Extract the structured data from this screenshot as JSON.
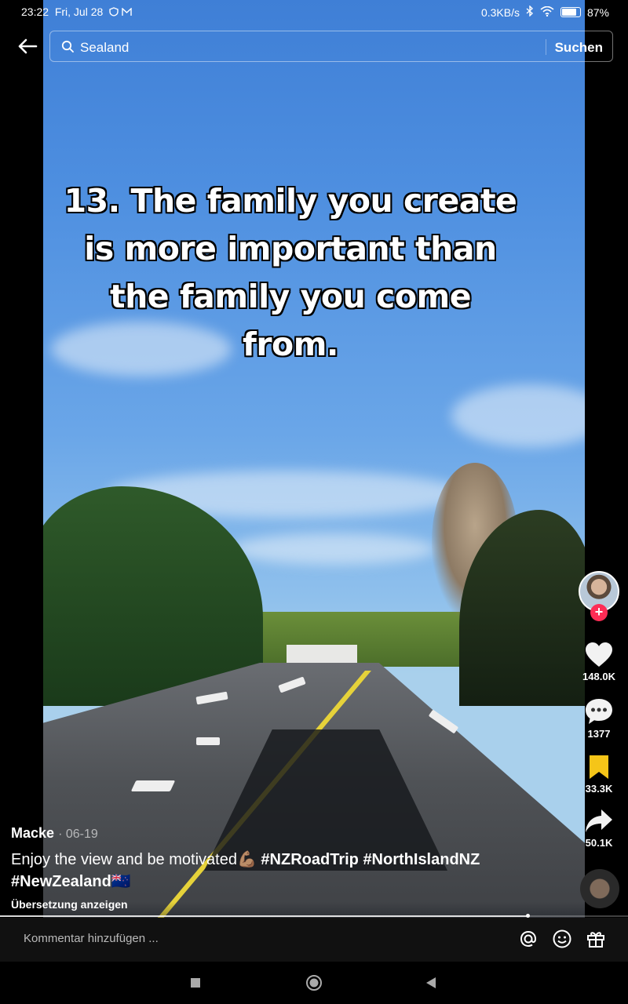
{
  "status_bar": {
    "time": "23:22",
    "date": "Fri, Jul 28",
    "speed": "0.3KB/s",
    "battery": "87%"
  },
  "search": {
    "query": "Sealand",
    "button_label": "Suchen"
  },
  "video": {
    "caption_lines": [
      "13. The family you create",
      "is more important than",
      "the family you come",
      "from."
    ],
    "progress_fraction": 0.84
  },
  "actions": {
    "likes": "148.0K",
    "comments": "1377",
    "saves": "33.3K",
    "shares": "50.1K"
  },
  "post": {
    "author": "Macke",
    "date": "06-19",
    "description_text": "Enjoy the view and be motivated",
    "description_emoji": "💪🏽",
    "hashtags_line1": [
      "#NZRoadTrip",
      "#NorthIslandNZ"
    ],
    "hashtag_line2": "#NewZealand",
    "flag_emoji": "🇳🇿",
    "translate_label": "Übersetzung anzeigen"
  },
  "comment": {
    "placeholder": "Kommentar hinzufügen ..."
  },
  "colors": {
    "follow_badge": "#fe2c55",
    "save_active": "#f5c518"
  }
}
